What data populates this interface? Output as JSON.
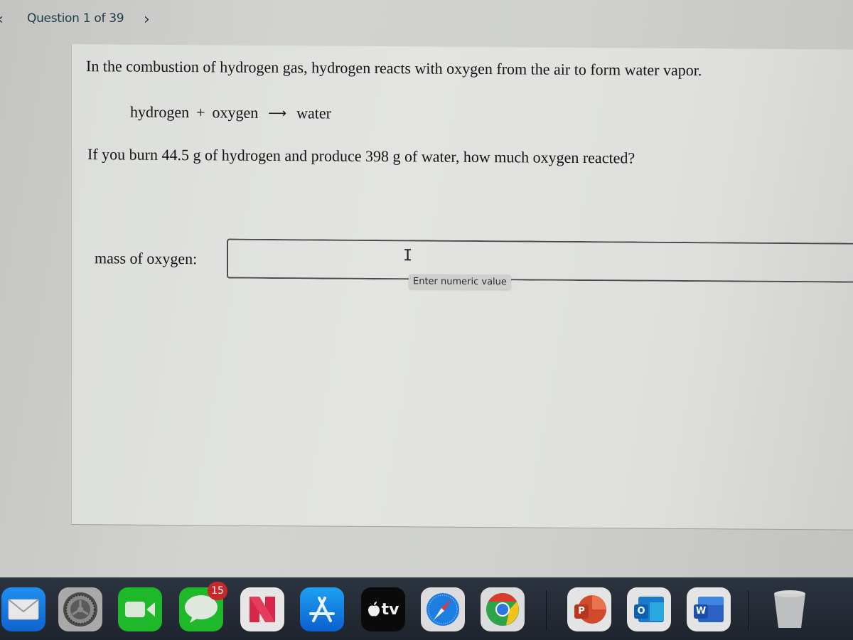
{
  "navigation": {
    "prev_icon": "‹",
    "question_counter": "Question 1 of 39",
    "next_icon": "›"
  },
  "question": {
    "intro": "In the combustion of hydrogen gas, hydrogen reacts with oxygen from the air to form water vapor.",
    "equation": {
      "reactant_1": "hydrogen",
      "plus": "+",
      "reactant_2": "oxygen",
      "arrow": "⟶",
      "product": "water"
    },
    "prompt": "If you burn 44.5 g of hydrogen and produce 398 g of water, how much oxygen reacted?"
  },
  "answer": {
    "label": "mass of oxygen:",
    "value": "",
    "placeholder": "",
    "tooltip": "Enter numeric value",
    "cursor_glyph": "I"
  },
  "dock": {
    "items": [
      {
        "name": "Mail",
        "icon": "mail-icon"
      },
      {
        "name": "System Preferences",
        "icon": "gear-icon"
      },
      {
        "name": "FaceTime",
        "icon": "video-camera-icon"
      },
      {
        "name": "Messages",
        "icon": "message-bubble-icon",
        "badge": "15"
      },
      {
        "name": "News",
        "icon": "news-icon"
      },
      {
        "name": "App Store",
        "icon": "app-store-icon"
      },
      {
        "name": "Apple TV",
        "icon": "apple-tv-icon",
        "label": "tv"
      },
      {
        "name": "Safari",
        "icon": "compass-icon"
      },
      {
        "name": "Google Chrome",
        "icon": "chrome-icon"
      },
      {
        "name": "PowerPoint",
        "icon": "powerpoint-icon",
        "letter": "P"
      },
      {
        "name": "Outlook",
        "icon": "outlook-icon",
        "letter": "O"
      },
      {
        "name": "Word",
        "icon": "word-icon",
        "letter": "W"
      },
      {
        "name": "Trash",
        "icon": "trash-icon"
      }
    ]
  },
  "colors": {
    "nav_text": "#1f3a44",
    "badge": "#c8282a",
    "dock_bg": "#252c36"
  }
}
